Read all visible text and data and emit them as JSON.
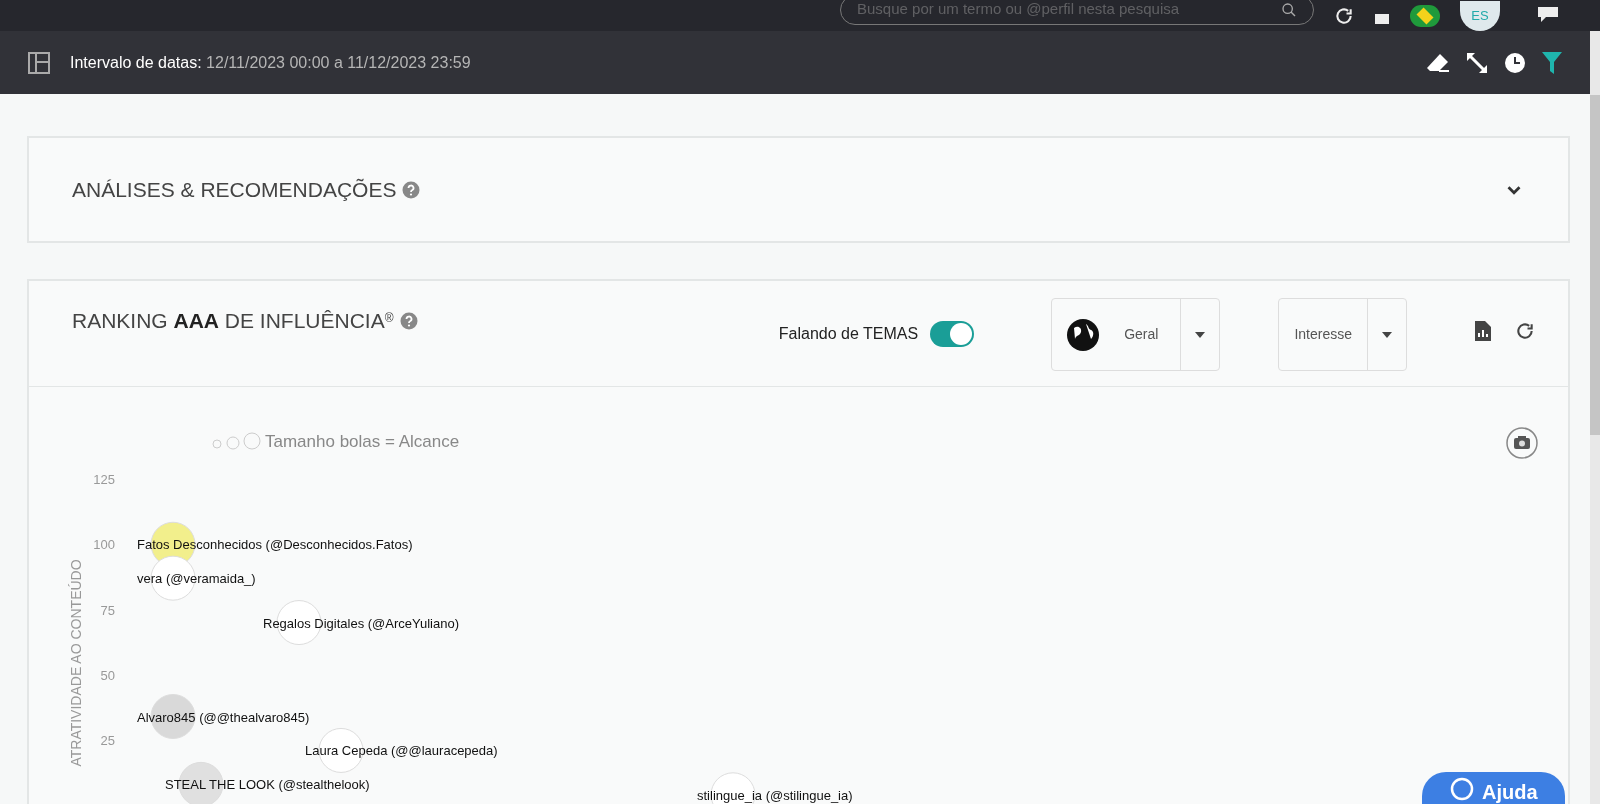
{
  "top_bar": {
    "search": {
      "placeholder": "Busque por um termo ou @perfil nesta pesquisa"
    },
    "avatar_initials": "ES"
  },
  "filter_bar": {
    "label": "Intervalo de datas:",
    "value": "12/11/2023 00:00 a 11/12/2023 23:59"
  },
  "analysis_panel": {
    "title": "ANÁLISES & RECOMENDAÇÕES",
    "expanded": false
  },
  "ranking_panel": {
    "title": "RANKING **AAA** DE INFLUÊNCIA$^{®}$",
    "toggle": {
      "label": "Falando de TEMAS",
      "on": true
    },
    "dropdowns": [
      {
        "kind": "globe",
        "label": "Geral"
      },
      {
        "kind": "plain",
        "label": "Interesse"
      }
    ],
    "bubble_chart": {
      "legend": "Tamanho bolas = Alcance",
      "y_axis_title": "ATRATIVIDADE AO CONTEÚDO",
      "y_tick_labels": [
        "125",
        "100",
        "75",
        "50",
        "25"
      ],
      "bubbles": [
        {
          "label": "Fatos Desconhecidos (@Desconhecidos.Fatos)",
          "color": "#f2ef8c"
        },
        {
          "label": "vera (@veramaida_)",
          "color": "#ffffff"
        },
        {
          "label": "Regalos Digitales (@ArceYuliano)",
          "color": "#ffffff"
        },
        {
          "label": "Alvaro845 (@@thealvaro845)",
          "color": "#d9d9d9"
        },
        {
          "label": "Laura Cepeda (@@lauracepeda)",
          "color": "#ffffff"
        },
        {
          "label": "STEAL THE LOOK (@stealthelook)",
          "color": "#e0e0e0"
        },
        {
          "label": "stilingue_ia (@stilingue_ia)",
          "color": "#ffffff"
        }
      ]
    }
  },
  "help_button": {
    "label": "Ajuda"
  }
}
